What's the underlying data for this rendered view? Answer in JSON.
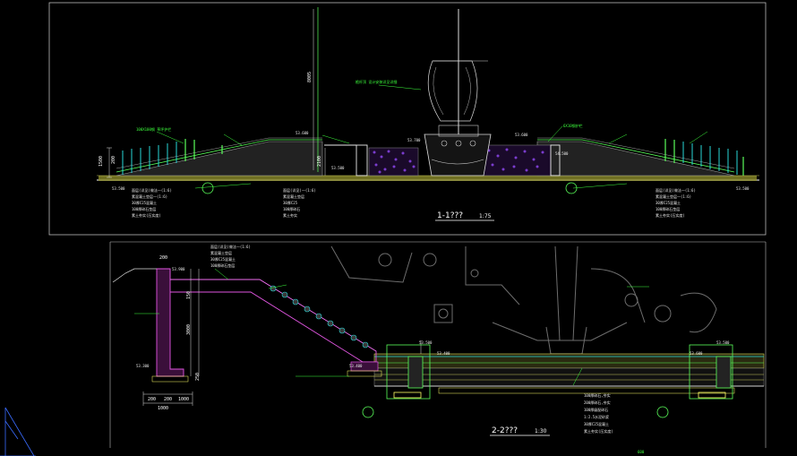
{
  "section_1": {
    "title": "1-1???",
    "scale": "1:75",
    "elevations": [
      "53.500",
      "53.500",
      "53.600",
      "53.700",
      "54.500",
      "53.600",
      "53.500"
    ],
    "dims": [
      "1500",
      "200",
      "2100",
      "8005"
    ],
    "note_mast": "桅杆顶  设计安装详见详细",
    "note_left": "100X100钢 草坪护栏",
    "note_right": "6X10钢护栏",
    "layers_left": [
      "面层(详见)做法一(1:6)",
      "素混凝土垫层一(1:6)",
      "30厚C25混凝土",
      "100厚碎石垫层",
      "素土夯实(压实度)"
    ],
    "layers_mid": [
      "面层(详见)一(1:6)",
      "素混凝土垫层",
      "30厚C25",
      "100厚碎石",
      "素土夯实"
    ],
    "layers_right": [
      "面层(详见)做法一(1:6)",
      "素混凝土垫层一(1:6)",
      "30厚C25混凝土",
      "100厚碎石垫层",
      "素土夯实(压实度)"
    ]
  },
  "section_2": {
    "title": "2-2???",
    "scale": "1:30",
    "elevations": [
      "53.900",
      "53.300",
      "53.400",
      "53.500",
      "53.400",
      "53.500",
      "53.600"
    ],
    "dims": [
      "200",
      "150",
      "3000",
      "200",
      "200",
      "1000",
      "1000",
      "250"
    ],
    "note_top": [
      "面层(详见)做法一(1:6)",
      "素混凝土垫层",
      "30厚C25混凝土",
      "100厚碎石垫层"
    ],
    "note_bottom": [
      "100厚碎石,夯实",
      "200厚碎石,夯实",
      "100厚级配碎石",
      "1:2.5水泥砂浆",
      "30厚C25混凝土",
      "素土夯实(压实度)"
    ],
    "footer": "600"
  }
}
